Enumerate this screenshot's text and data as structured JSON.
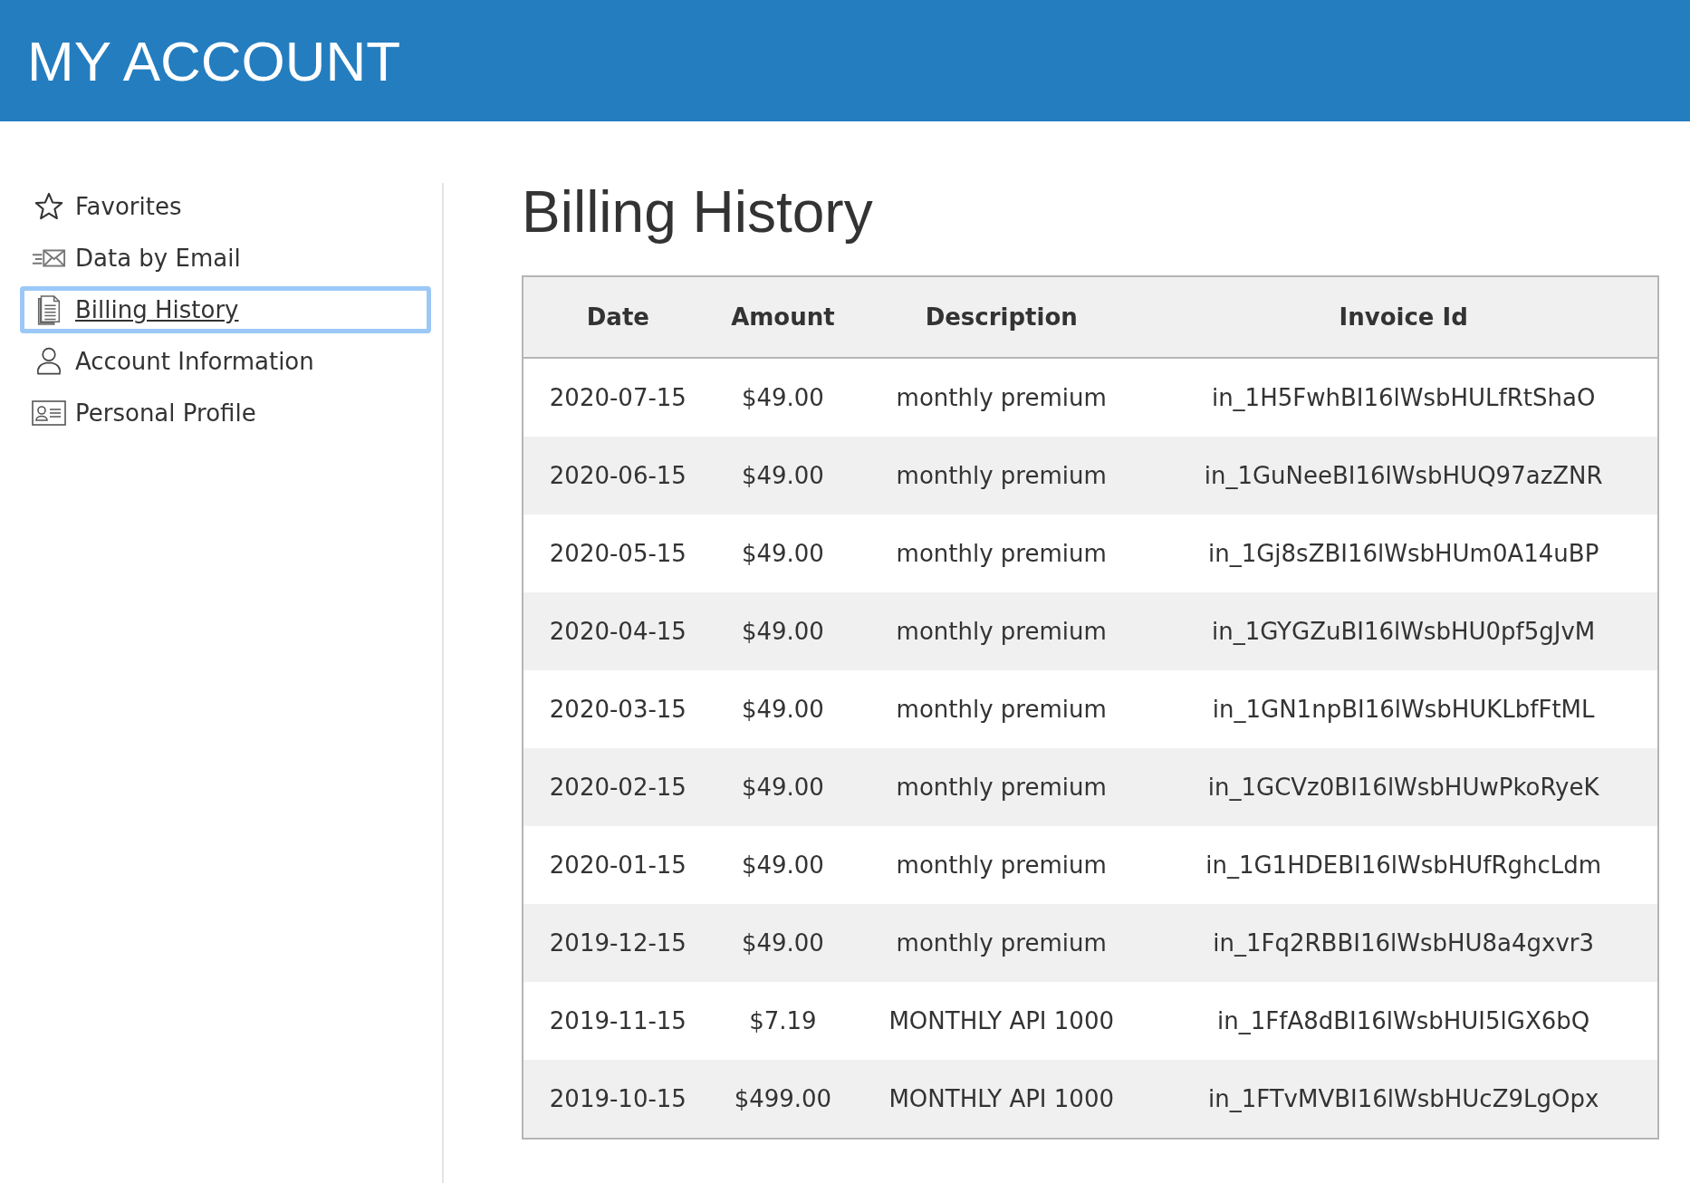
{
  "header": {
    "title": "MY ACCOUNT"
  },
  "sidebar": {
    "items": [
      {
        "label": "Favorites",
        "kind": "star",
        "selected": false
      },
      {
        "label": "Data by Email",
        "kind": "email",
        "selected": false
      },
      {
        "label": "Billing History",
        "kind": "document",
        "selected": true
      },
      {
        "label": "Account Information",
        "kind": "person",
        "selected": false
      },
      {
        "label": "Personal Profile",
        "kind": "card",
        "selected": false
      }
    ]
  },
  "main": {
    "heading": "Billing History",
    "table": {
      "columns": [
        "Date",
        "Amount",
        "Description",
        "Invoice Id"
      ],
      "rows": [
        [
          "2020-07-15",
          "$49.00",
          "monthly premium",
          "in_1H5FwhBI16lWsbHULfRtShaO"
        ],
        [
          "2020-06-15",
          "$49.00",
          "monthly premium",
          "in_1GuNeeBI16lWsbHUQ97azZNR"
        ],
        [
          "2020-05-15",
          "$49.00",
          "monthly premium",
          "in_1Gj8sZBI16lWsbHUm0A14uBP"
        ],
        [
          "2020-04-15",
          "$49.00",
          "monthly premium",
          "in_1GYGZuBI16lWsbHU0pf5gJvM"
        ],
        [
          "2020-03-15",
          "$49.00",
          "monthly premium",
          "in_1GN1npBI16lWsbHUKLbfFtML"
        ],
        [
          "2020-02-15",
          "$49.00",
          "monthly premium",
          "in_1GCVz0BI16lWsbHUwPkoRyeK"
        ],
        [
          "2020-01-15",
          "$49.00",
          "monthly premium",
          "in_1G1HDEBI16lWsbHUfRghcLdm"
        ],
        [
          "2019-12-15",
          "$49.00",
          "monthly premium",
          "in_1Fq2RBBI16lWsbHU8a4gxvr3"
        ],
        [
          "2019-11-15",
          "$7.19",
          "MONTHLY API 1000",
          "in_1FfA8dBI16lWsbHUI5lGX6bQ"
        ],
        [
          "2019-10-15",
          "$499.00",
          "MONTHLY API 1000",
          "in_1FTvMVBI16lWsbHUcZ9LgOpx"
        ]
      ]
    }
  }
}
